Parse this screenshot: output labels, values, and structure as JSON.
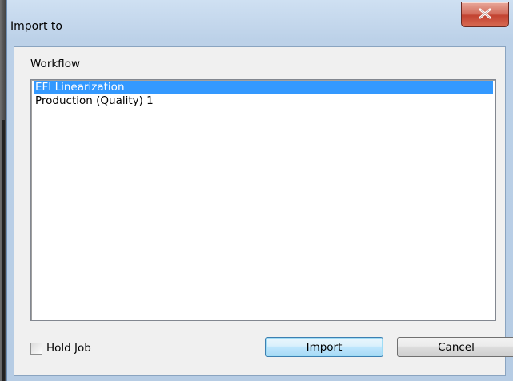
{
  "window": {
    "title": "Import to"
  },
  "workflow": {
    "label": "Workflow",
    "items": [
      {
        "label": "EFI Linearization",
        "selected": true
      },
      {
        "label": "Production (Quality) 1",
        "selected": false
      }
    ]
  },
  "options": {
    "hold_job_label": "Hold Job",
    "hold_job_checked": false
  },
  "buttons": {
    "import_label": "Import",
    "cancel_label": "Cancel"
  },
  "icons": {
    "close": "close-icon"
  },
  "colors": {
    "selection": "#3399ff",
    "close_button": "#c24331"
  }
}
